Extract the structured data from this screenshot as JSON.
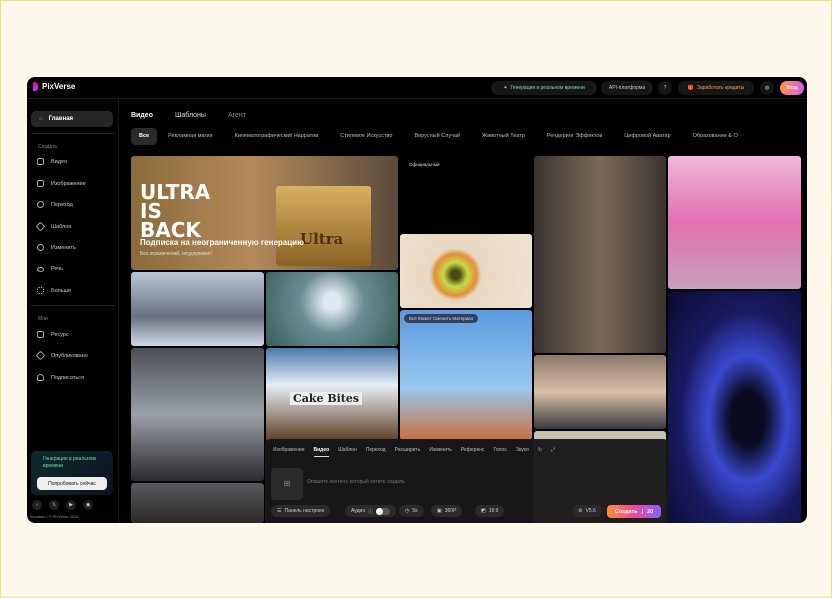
{
  "app": {
    "name": "PixVerse"
  },
  "topbar": {
    "realtime": "Генерация в реальном времени",
    "api": "API-платформа",
    "earn": "Заработать кредиты",
    "login": "Вход"
  },
  "sidebar": {
    "home": "Главная",
    "create_label": "Создать",
    "create_items": [
      "Видео",
      "Изображение",
      "Переход",
      "Шаблон",
      "Изменить",
      "Речь",
      "Больше"
    ],
    "mine_label": "Мои",
    "mine_items": [
      "Ресурс",
      "Опубликовано",
      "Подписаться"
    ],
    "promo": {
      "title": "Генерация в реальном времени",
      "button": "Попробовать сейчас"
    },
    "footer": "Условия | © PixVerse 2026"
  },
  "main": {
    "tabs": [
      "Видео",
      "Шаблоны",
      "Агент"
    ],
    "categories": [
      "Все",
      "Рекламная магия",
      "Кинематографический Нарратив",
      "Стилевое Искусство",
      "Вирусный Случай",
      "Животный Театр",
      "Рендеринг Эффектов",
      "Цифровой Аватар",
      "Образование & О"
    ]
  },
  "hero": {
    "title": "ULTRA IS BACK",
    "subtitle": "Подписка на неограниченную генерацию",
    "caption": "Без ограничений, неудержимо!",
    "box_text": "Ultra"
  },
  "gallery": {
    "official": "Официальный",
    "material": "Всё Может Сменить Материал",
    "cake": "Cake Bites"
  },
  "prompt": {
    "tabs": [
      "Изображение",
      "Видео",
      "Шаблон",
      "Переход",
      "Расширить",
      "Изменить",
      "Референс",
      "Голос",
      "Звуко"
    ],
    "placeholder": "Опишите контент, который хотите создать",
    "settings": "Панель настроек",
    "audio": "Аудио",
    "duration": "5s",
    "resolution": "360P",
    "ratio": "16:9",
    "model": "V5.6",
    "create": "Создать",
    "cost": "20"
  }
}
